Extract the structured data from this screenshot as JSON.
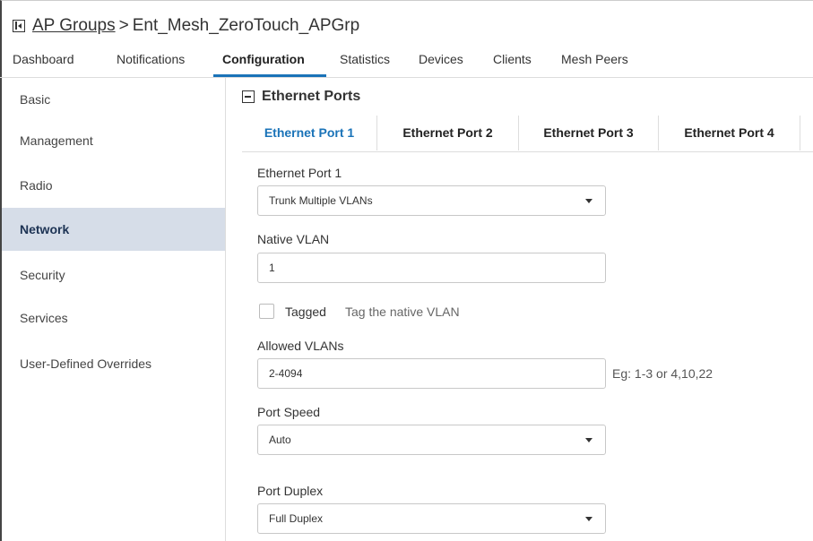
{
  "header": {
    "collapse_icon": "collapse-sidebar-icon",
    "crumb_link": "AP Groups",
    "separator": ">",
    "current": "Ent_Mesh_ZeroTouch_APGrp"
  },
  "tabs": [
    {
      "label": "Dashboard"
    },
    {
      "label": "Notifications"
    },
    {
      "label": "Configuration",
      "active": true
    },
    {
      "label": "Statistics"
    },
    {
      "label": "Devices"
    },
    {
      "label": "Clients"
    },
    {
      "label": "Mesh Peers"
    }
  ],
  "sidebar": {
    "items": [
      {
        "label": "Basic"
      },
      {
        "label": "Management"
      },
      {
        "label": "Radio"
      },
      {
        "label": "Network",
        "active": true
      },
      {
        "label": "Security"
      },
      {
        "label": "Services"
      },
      {
        "label": "User-Defined Overrides"
      }
    ]
  },
  "section": {
    "title": "Ethernet Ports",
    "icon": "collapse-minus-icon"
  },
  "port_tabs": [
    {
      "label": "Ethernet Port 1",
      "active": true
    },
    {
      "label": "Ethernet Port 2"
    },
    {
      "label": "Ethernet Port 3"
    },
    {
      "label": "Ethernet Port 4"
    }
  ],
  "form": {
    "port_label": "Ethernet Port 1",
    "port_mode": "Trunk Multiple VLANs",
    "native_vlan_label": "Native VLAN",
    "native_vlan_value": "1",
    "tagged_label": "Tagged",
    "tagged_hint": "Tag the native VLAN",
    "tagged_checked": false,
    "allowed_vlans_label": "Allowed VLANs",
    "allowed_vlans_value": "2-4094",
    "allowed_vlans_hint": "Eg: 1-3 or 4,10,22",
    "port_speed_label": "Port Speed",
    "port_speed_value": "Auto",
    "port_duplex_label": "Port Duplex",
    "port_duplex_value": "Full Duplex"
  },
  "colors": {
    "accent": "#1a73b8",
    "active_sidebar_bg": "#d6dde8"
  }
}
